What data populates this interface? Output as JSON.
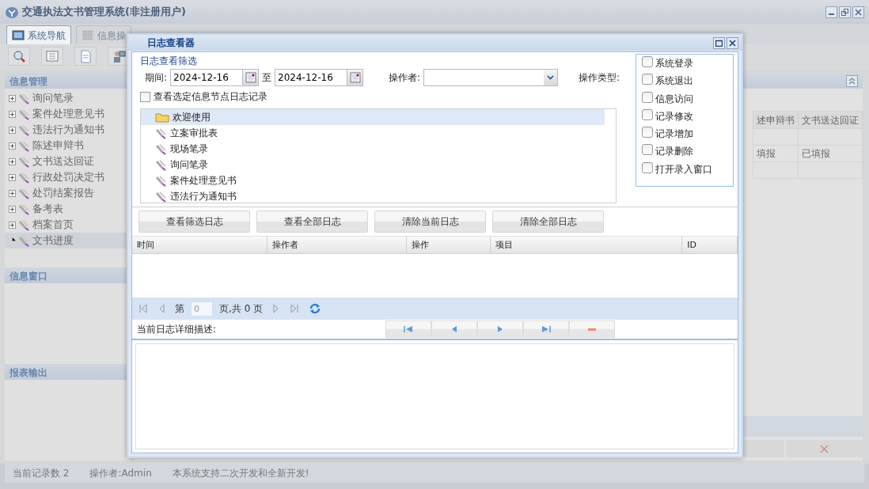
{
  "window": {
    "title": "交通执法文书管理系统(非注册用户)"
  },
  "tabs": [
    {
      "label": "系统导航",
      "selected": true
    },
    {
      "label": "信息操",
      "selected": false
    }
  ],
  "sidebar": {
    "sections": [
      {
        "title": "信息管理",
        "items": [
          {
            "label": "询问笔录",
            "expandable": true,
            "selected": false
          },
          {
            "label": "案件处理意见书",
            "expandable": true,
            "selected": false
          },
          {
            "label": "违法行为通知书",
            "expandable": true,
            "selected": false
          },
          {
            "label": "陈述申辩书",
            "expandable": true,
            "selected": false
          },
          {
            "label": "文书送达回证",
            "expandable": true,
            "selected": false
          },
          {
            "label": "行政处罚决定书",
            "expandable": true,
            "selected": false
          },
          {
            "label": "处罚结案报告",
            "expandable": true,
            "selected": false
          },
          {
            "label": "备考表",
            "expandable": true,
            "selected": false
          },
          {
            "label": "档案首页",
            "expandable": true,
            "selected": false
          },
          {
            "label": "文书进度",
            "expandable": false,
            "selected": true
          }
        ]
      },
      {
        "title": "信息窗口"
      },
      {
        "title": "报表输出"
      }
    ]
  },
  "progress_table": {
    "columns": [
      "述申辩书",
      "文书送达回证"
    ],
    "rows": [
      [
        "填报",
        "已填报"
      ]
    ]
  },
  "dialog": {
    "title": "日志查看器",
    "filter": {
      "title": "日志查看筛选",
      "period_label": "期间:",
      "start_date": "2024-12-16",
      "to_label": "至",
      "end_date": "2024-12-16",
      "operator_label": "操作者:",
      "type_label": "操作类型:",
      "node_only": {
        "label": "查看选定信息节点日志记录",
        "checked": false
      },
      "types": [
        {
          "label": "系统登录",
          "checked": false
        },
        {
          "label": "系统退出",
          "checked": false
        },
        {
          "label": "信息访问",
          "checked": false
        },
        {
          "label": "记录修改",
          "checked": false
        },
        {
          "label": "记录增加",
          "checked": false
        },
        {
          "label": "记录删除",
          "checked": false
        },
        {
          "label": "打开录入窗口",
          "checked": false
        }
      ]
    },
    "tree": {
      "label": "欢迎使用",
      "selected": true,
      "children": [
        {
          "label": "立案审批表",
          "selected": false
        },
        {
          "label": "现场笔录",
          "selected": false
        },
        {
          "label": "询问笔录",
          "selected": false
        },
        {
          "label": "案件处理意见书",
          "selected": false
        },
        {
          "label": "违法行为通知书",
          "selected": false
        }
      ]
    },
    "buttons": [
      "查看筛选日志",
      "查看全部日志",
      "清除当前日志",
      "清除全部日志"
    ],
    "grid": {
      "columns": [
        "时间",
        "操作者",
        "操作",
        "项目",
        "ID"
      ]
    },
    "pager": {
      "page_label": "第",
      "page": "0",
      "total": "页,共 0 页"
    },
    "detail": {
      "label": "当前日志详细描述:"
    }
  },
  "status_bar": [
    "当前记录数 2",
    "操作者:Admin",
    "本系统支持二次开发和全新开发!"
  ]
}
